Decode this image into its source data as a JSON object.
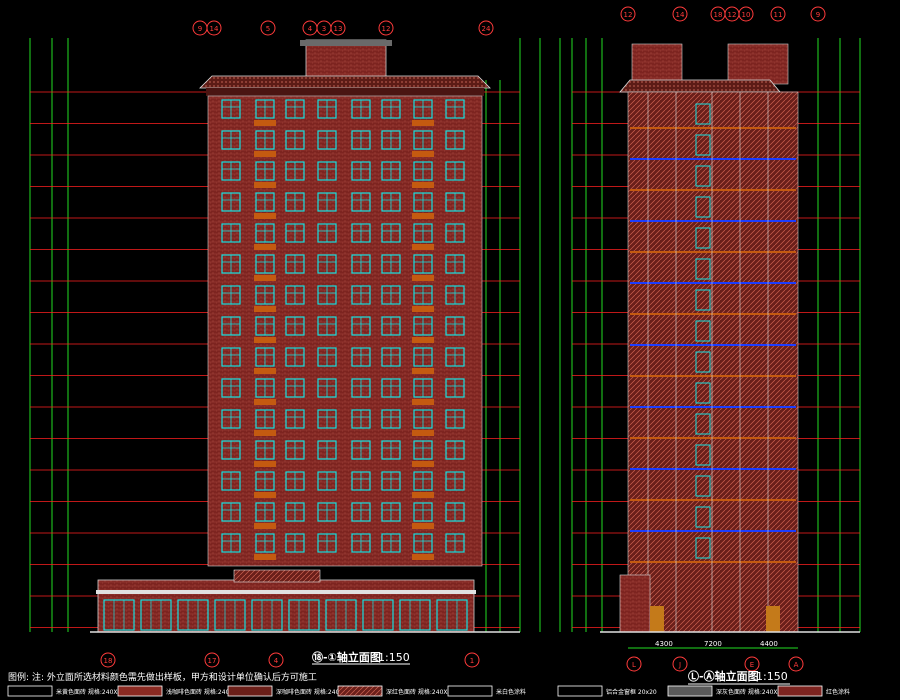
{
  "colors": {
    "background": "#000000",
    "facade": "#8a2a22",
    "roof_band": "#6b1f19",
    "window_frame": "#14e0e0",
    "floor_line": "#ff2020",
    "dim_line": "#22dd22",
    "balcony": "#c45a10",
    "floor_marker_blue": "#1c3cff",
    "text_white": "#ffffff",
    "text_yellow": "#ffff00"
  },
  "left_view": {
    "title": "⑱-①轴立面图",
    "scale": "1:150",
    "axis_bottom": [
      "18",
      "17",
      "4",
      "1"
    ],
    "axis_top": [
      "9",
      "14",
      "5",
      "4",
      "3",
      "13",
      "12",
      "24"
    ]
  },
  "right_view": {
    "title": "Ⓛ-Ⓐ轴立面图",
    "scale": "1:150",
    "axis_bottom": [
      "L",
      "J",
      "E",
      "A"
    ],
    "axis_top": [
      "12",
      "14",
      "18",
      "12",
      "10",
      "11",
      "9"
    ],
    "bottom_dims": [
      "4300",
      "7200",
      "4400"
    ]
  },
  "notes": {
    "legend_label": "图例:",
    "note_text": "注: 外立面所选材料颜色需先做出样板，甲方和设计单位确认后方可施工",
    "legend_items": [
      {
        "label": "米黄色面砖",
        "spec": "规格:240X60"
      },
      {
        "label": "浅咖啡色面砖",
        "spec": "规格:240X60"
      },
      {
        "label": "深咖啡色面砖",
        "spec": "规格:240X60"
      },
      {
        "label": "深红色面砖",
        "spec": "规格:240X60"
      },
      {
        "label": "米白色涂料",
        "spec": ""
      },
      {
        "label": "铝合金窗框",
        "spec": "20x20"
      },
      {
        "label": "深灰色面砖",
        "spec": "规格:240X60"
      },
      {
        "label": "红色涂料",
        "spec": ""
      }
    ]
  }
}
